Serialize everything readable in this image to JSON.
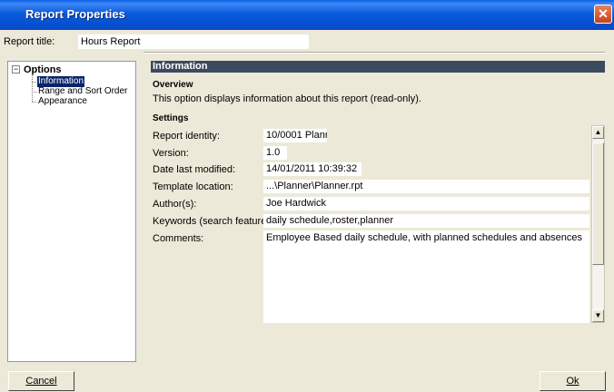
{
  "window": {
    "title": "Report Properties",
    "close_glyph": "✕"
  },
  "report_title": {
    "label": "Report title:",
    "value": "Hours Report"
  },
  "tree": {
    "toggle_glyph": "−",
    "root_label": "Options",
    "items": [
      {
        "label": "Information",
        "selected": true
      },
      {
        "label": "Range and Sort Order",
        "selected": false
      },
      {
        "label": "Appearance",
        "selected": false
      }
    ]
  },
  "panel": {
    "header": "Information",
    "overview_heading": "Overview",
    "overview_text": "This option displays information about this report (read-only).",
    "settings_heading": "Settings",
    "fields": [
      {
        "label": "Report identity:",
        "value": "10/0001 Plann"
      },
      {
        "label": "Version:",
        "value": "1.0"
      },
      {
        "label": "Date last modified:",
        "value": "14/01/2011 10:39:32"
      },
      {
        "label": "Template location:",
        "value": "...\\Planner\\Planner.rpt"
      },
      {
        "label": "Author(s):",
        "value": "Joe Hardwick"
      },
      {
        "label": "Keywords (search feature):",
        "value": "daily schedule,roster,planner"
      },
      {
        "label": "Comments:",
        "value": "Employee Based daily schedule, with planned schedules and absences"
      }
    ],
    "scroll_up_glyph": "▲",
    "scroll_down_glyph": "▼"
  },
  "buttons": {
    "cancel": "Cancel",
    "ok": "Ok"
  },
  "colors": {
    "titlebar": "#0a5bdc",
    "panel_header": "#3c4a5e",
    "selection": "#0a246a",
    "dialog_bg": "#ece9d8"
  }
}
